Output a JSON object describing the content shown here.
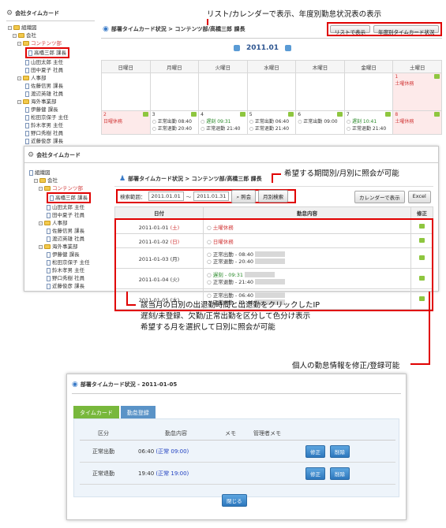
{
  "callouts": {
    "top": "リスト/カレンダーで表示、年度別勤怠状況表の表示",
    "period": "希望する期間別/月別に照会が可能",
    "bottom_lines": [
      "該当月の日別の出退勤時間と出退勤をクリックしたIP",
      "遅刻/未登録、欠勤/正常出勤を区分して色分け表示",
      "希望する月を選択して日別に照会が可能"
    ],
    "edit": "個人の勤怠情報を修正/登録可能"
  },
  "panel1": {
    "left_title": "会社タイムカード",
    "main_title": "部署タイムカード状況 > コンテンツ部/高橋三郎 課長",
    "btn_list": "リストで表示",
    "btn_year": "年度別タイムカード状況",
    "month": "2011.01",
    "tree": [
      "組織図",
      "会社",
      "コンテンツ部",
      "高橋三郎 課長",
      "山田太郎 主任",
      "田中夏子 社員",
      "人事部",
      "佐藤信男 課長",
      "渡辺英雄 社員",
      "海外事業部",
      "伊藤健 課長",
      "松田京保子 主任",
      "鈴木孝男 主任",
      "野口秀樹 社員",
      "近藤俊彦 課長"
    ],
    "weekdays": [
      "日曜日",
      "月曜日",
      "火曜日",
      "水曜日",
      "木曜日",
      "金曜日",
      "土曜日"
    ],
    "cell1_day": "1",
    "cell1_label": "土曜休務",
    "week2": [
      {
        "day": "2",
        "lines": [
          "日曜休務"
        ]
      },
      {
        "day": "3",
        "lines": [
          "正常出勤 08:40",
          "正常退勤 20:40"
        ]
      },
      {
        "day": "4",
        "lines": [
          "遅刻 09:31",
          "正常退勤 21:40"
        ]
      },
      {
        "day": "5",
        "lines": [
          "正常出勤 06:40",
          "正常退勤 21:40"
        ]
      },
      {
        "day": "6",
        "lines": [
          "正常出勤 09:00",
          ""
        ]
      },
      {
        "day": "7",
        "lines": [
          "遅刻 10:41",
          "正常退勤 21:40"
        ]
      },
      {
        "day": "8",
        "lines": [
          "土曜休務"
        ]
      }
    ]
  },
  "panel2": {
    "left_title": "会社タイムカード",
    "main_title": "部署タイムカード状況 > コンテンツ部/高橋三郎 課長",
    "search_label": "検索範囲：",
    "date_from": "2011.01.01",
    "tilde": "～",
    "date_to": "2011.01.31",
    "btn_search": "照会",
    "btn_month": "月別検索",
    "btn_calendar": "カレンダーで表示",
    "btn_excel": "Excel",
    "col_date": "日付",
    "col_content": "勤怠内容",
    "col_edit": "修正",
    "tree": [
      "組織図",
      "会社",
      "コンテンツ部",
      "高橋三郎 課長",
      "山田太郎 主任",
      "田中夏子 社員",
      "人事部",
      "佐藤信男 課長",
      "渡辺英雄 社員",
      "海外事業部",
      "伊藤健 課長",
      "松田京保子 主任",
      "鈴木孝男 主任",
      "野口秀樹 社員",
      "近藤俊彦 課長"
    ],
    "rows": [
      {
        "date": "2011-01-01",
        "dow": "(土)",
        "l1": "土曜休務",
        "l2": ""
      },
      {
        "date": "2011-01-02",
        "dow": "(日)",
        "l1": "日曜休務",
        "l2": ""
      },
      {
        "date": "2011-01-03",
        "dow": "(月)",
        "l1": "正常出勤 - 08:40",
        "l2": "正常退勤 - 20:40"
      },
      {
        "date": "2011-01-04",
        "dow": "(火)",
        "l1": "遅刻 - 09:31",
        "l2": "正常退勤 - 21:40"
      },
      {
        "date": "2011-01-05",
        "dow": "(水)",
        "l1": "正常出勤 - 06:40",
        "l2": "正常退勤 - 21:40"
      }
    ]
  },
  "panel3": {
    "title": "部署タイムカード状況 - 2011-01-05",
    "tab1": "タイムカード",
    "tab2": "勤怠登録",
    "col_kubun": "区分",
    "col_content": "勤怠内容",
    "col_memo": "メモ",
    "col_admin": "管理者メモ",
    "rows": [
      {
        "kubun": "正常出勤",
        "time": "06:40",
        "normal": "(正常 09:00)"
      },
      {
        "kubun": "正常退勤",
        "time": "19:40",
        "normal": "(正常 19:00)"
      }
    ],
    "btn_edit": "修正",
    "btn_delete": "削除",
    "btn_close": "閉じる"
  }
}
